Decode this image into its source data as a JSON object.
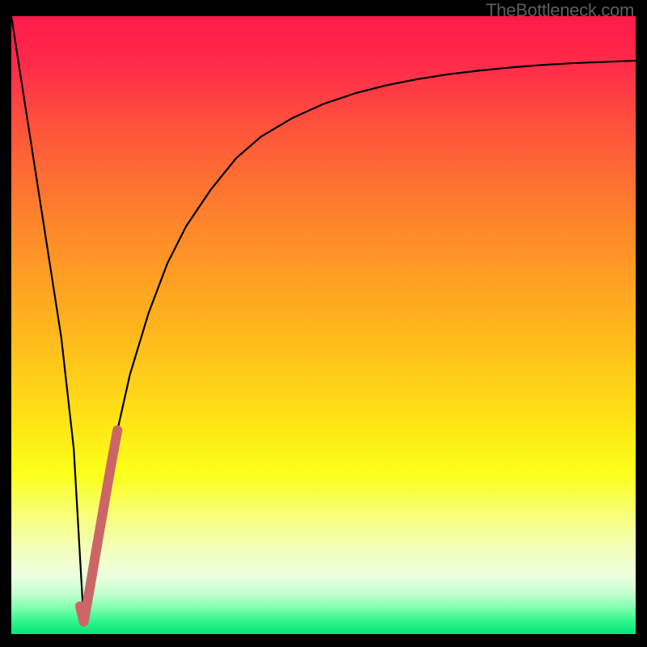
{
  "watermark": "TheBottleneck.com",
  "colors": {
    "frame": "#000000",
    "gradient_stops": [
      {
        "offset": 0.0,
        "color": "#ff1a4b"
      },
      {
        "offset": 0.08,
        "color": "#ff2c4a"
      },
      {
        "offset": 0.2,
        "color": "#ff5a3a"
      },
      {
        "offset": 0.35,
        "color": "#ff8a2a"
      },
      {
        "offset": 0.5,
        "color": "#ffb41e"
      },
      {
        "offset": 0.65,
        "color": "#ffe215"
      },
      {
        "offset": 0.74,
        "color": "#fbff1a"
      },
      {
        "offset": 0.8,
        "color": "#f7ff6e"
      },
      {
        "offset": 0.86,
        "color": "#f3ffb8"
      },
      {
        "offset": 0.905,
        "color": "#ecffe0"
      },
      {
        "offset": 0.935,
        "color": "#c3ffcf"
      },
      {
        "offset": 0.958,
        "color": "#7fffad"
      },
      {
        "offset": 0.978,
        "color": "#35f58e"
      },
      {
        "offset": 1.0,
        "color": "#00e676"
      }
    ],
    "curve": "#000000",
    "segment": "#cc6666"
  },
  "chart_data": {
    "type": "line",
    "title": "",
    "xlabel": "",
    "ylabel": "",
    "xlim": [
      0,
      100
    ],
    "ylim": [
      0,
      100
    ],
    "series": [
      {
        "name": "bottleneck-curve",
        "x": [
          0,
          2,
          4,
          6,
          8,
          10,
          11.6,
          13,
          15,
          17,
          19,
          22,
          25,
          28,
          32,
          36,
          40,
          45,
          50,
          55,
          60,
          65,
          70,
          75,
          80,
          85,
          90,
          95,
          100
        ],
        "y": [
          100,
          87,
          74,
          61,
          48,
          30,
          2,
          10,
          22,
          33,
          42,
          52,
          60,
          66,
          72,
          77,
          80.5,
          83.5,
          85.8,
          87.5,
          88.8,
          89.8,
          90.6,
          91.2,
          91.7,
          92.1,
          92.4,
          92.6,
          92.8
        ]
      },
      {
        "name": "highlight-segment",
        "x": [
          11.0,
          11.6,
          12.5,
          13.5,
          14.7,
          16.0,
          17.0
        ],
        "y": [
          4.5,
          2.0,
          7.0,
          13.0,
          20.0,
          27.5,
          33.0
        ]
      }
    ]
  }
}
